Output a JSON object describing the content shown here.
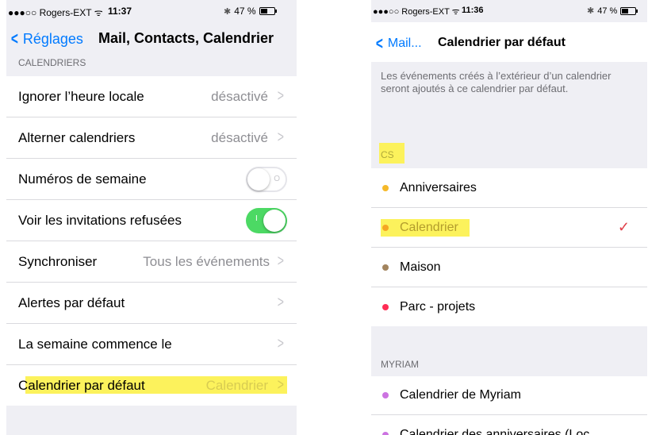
{
  "left": {
    "status": {
      "carrier": "●●●○○ Rogers-EXT ᯤ",
      "time": "11:37",
      "battery": "47 %",
      "battery_fraction": 0.47
    },
    "nav": {
      "back_label": "Réglages",
      "title": "Mail, Contacts, Calendrier"
    },
    "section_header": "CALENDRIERS",
    "rows": [
      {
        "label": "Ignorer l’heure locale",
        "value": "désactivé"
      },
      {
        "label": "Alterner calendriers",
        "value": "désactivé"
      },
      {
        "label": "Numéros de semaine",
        "toggle": "off"
      },
      {
        "label": "Voir les invitations refusées",
        "toggle": "on"
      },
      {
        "label": "Synchroniser",
        "value": "Tous les événements"
      },
      {
        "label": "Alertes par défaut",
        "value": ""
      },
      {
        "label": "La semaine commence le",
        "value": ""
      },
      {
        "label": "Calendrier par défaut",
        "value": "Calendrier",
        "highlighted": true
      }
    ]
  },
  "right": {
    "status": {
      "carrier": "●●●○○ Rogers-EXT ᯤ",
      "time": "11:36",
      "battery": "47 %",
      "battery_fraction": 0.47
    },
    "nav": {
      "back_label": "Mail...",
      "title": "Calendrier par défaut"
    },
    "description": "Les événements créés à l’extérieur d’un calendrier seront ajoutés à ce calendrier par défaut.",
    "section1_header": "CS",
    "section1_items": [
      {
        "label": "Anniversaires",
        "color": "#f5b92a"
      },
      {
        "label": "Calendrier",
        "color": "#f5a623",
        "selected": true,
        "highlighted": true
      },
      {
        "label": "Maison",
        "color": "#a2845e"
      },
      {
        "label": "Parc - projets",
        "color": "#ff2d55"
      }
    ],
    "section2_header": "MYRIAM",
    "section2_items": [
      {
        "label": "Calendrier de Myriam",
        "color": "#cc73e1"
      },
      {
        "label": "Calendrier des anniversaires (Loc",
        "color": "#cc73e1"
      }
    ]
  },
  "icons": {
    "back": "chevron-left-icon",
    "disclosure": "chevron-right-icon",
    "check": "checkmark-icon",
    "bluetooth": "bluetooth-icon"
  },
  "colors": {
    "ios_blue": "#007aff",
    "toggle_on": "#4cd964",
    "highlight": "#fcf25c",
    "check": "#e0404a"
  }
}
